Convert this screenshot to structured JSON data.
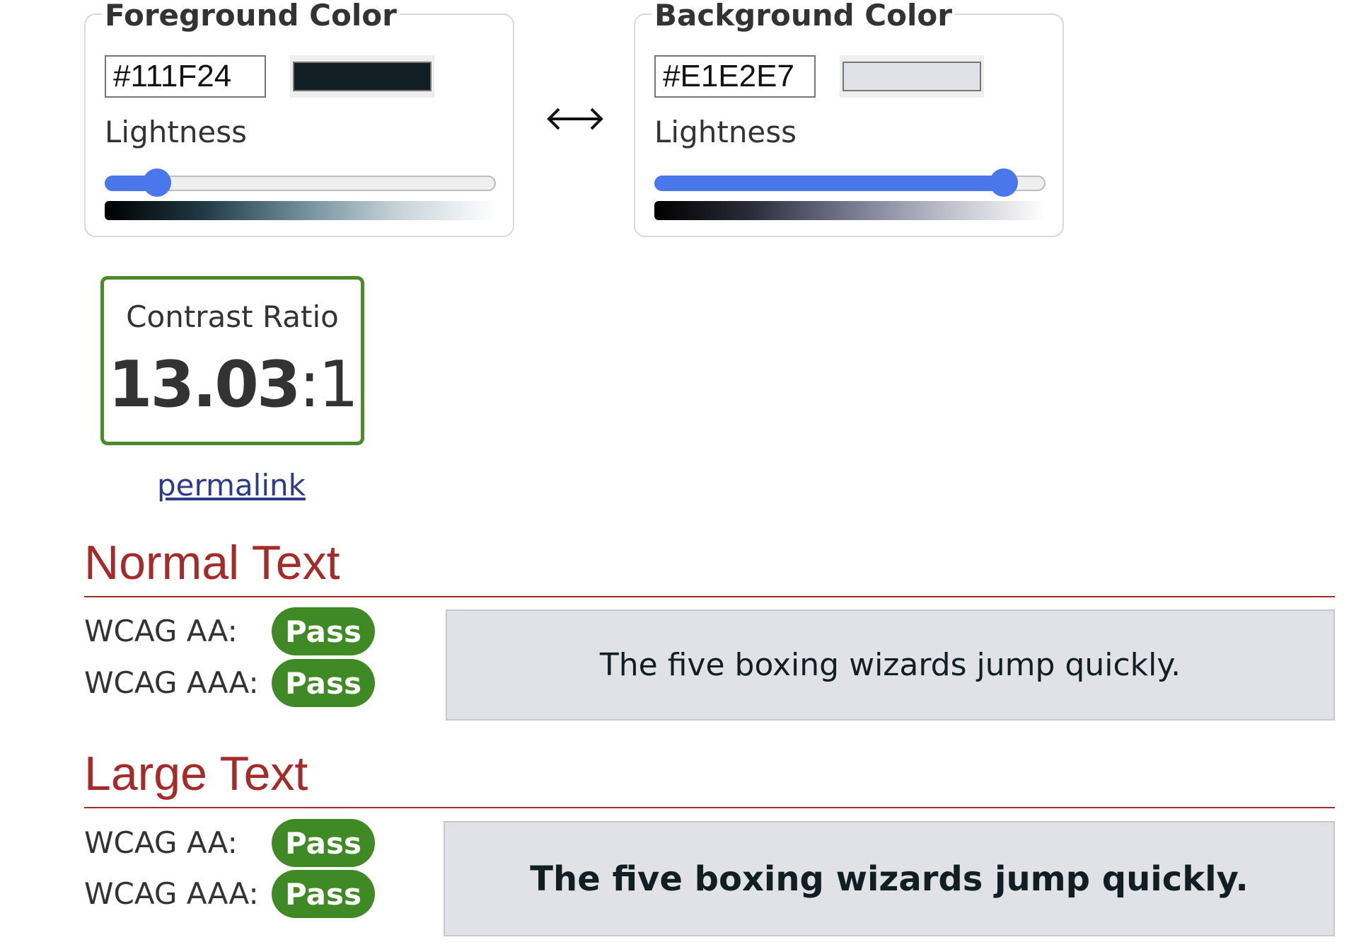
{
  "foreground": {
    "legend": "Foreground Color",
    "hex_value": "#111F24",
    "swatch_color": "#111F24",
    "lightness_label": "Lightness",
    "lightness_percent": 13,
    "gradient_colors": [
      "#000000",
      "#1f3a44",
      "#6e8d99",
      "#c7d3d8",
      "#ffffff"
    ]
  },
  "background": {
    "legend": "Background Color",
    "hex_value": "#E1E2E7",
    "swatch_color": "#E1E2E7",
    "lightness_label": "Lightness",
    "lightness_percent": 89,
    "gradient_colors": [
      "#000000",
      "#2c2d3a",
      "#767891",
      "#bfc0cb",
      "#ffffff"
    ]
  },
  "swap": {
    "icon": "swap-arrows-icon"
  },
  "contrast": {
    "label": "Contrast Ratio",
    "value": "13.03",
    "suffix": ":1",
    "border_color": "#4a8a29"
  },
  "permalink": {
    "label": "permalink"
  },
  "normal_text": {
    "title": "Normal Text",
    "aa_label": "WCAG AA:",
    "aa_result": "Pass",
    "aaa_label": "WCAG AAA:",
    "aaa_result": "Pass",
    "sample": "The five boxing wizards jump quickly."
  },
  "large_text": {
    "title": "Large Text",
    "aa_label": "WCAG AA:",
    "aa_result": "Pass",
    "aaa_label": "WCAG AAA:",
    "aaa_result": "Pass",
    "sample": "The five boxing wizards jump quickly."
  },
  "colors": {
    "accent_red": "#a52a2a",
    "pass_green": "#3f8a25",
    "slider_blue": "#4a78ec"
  }
}
